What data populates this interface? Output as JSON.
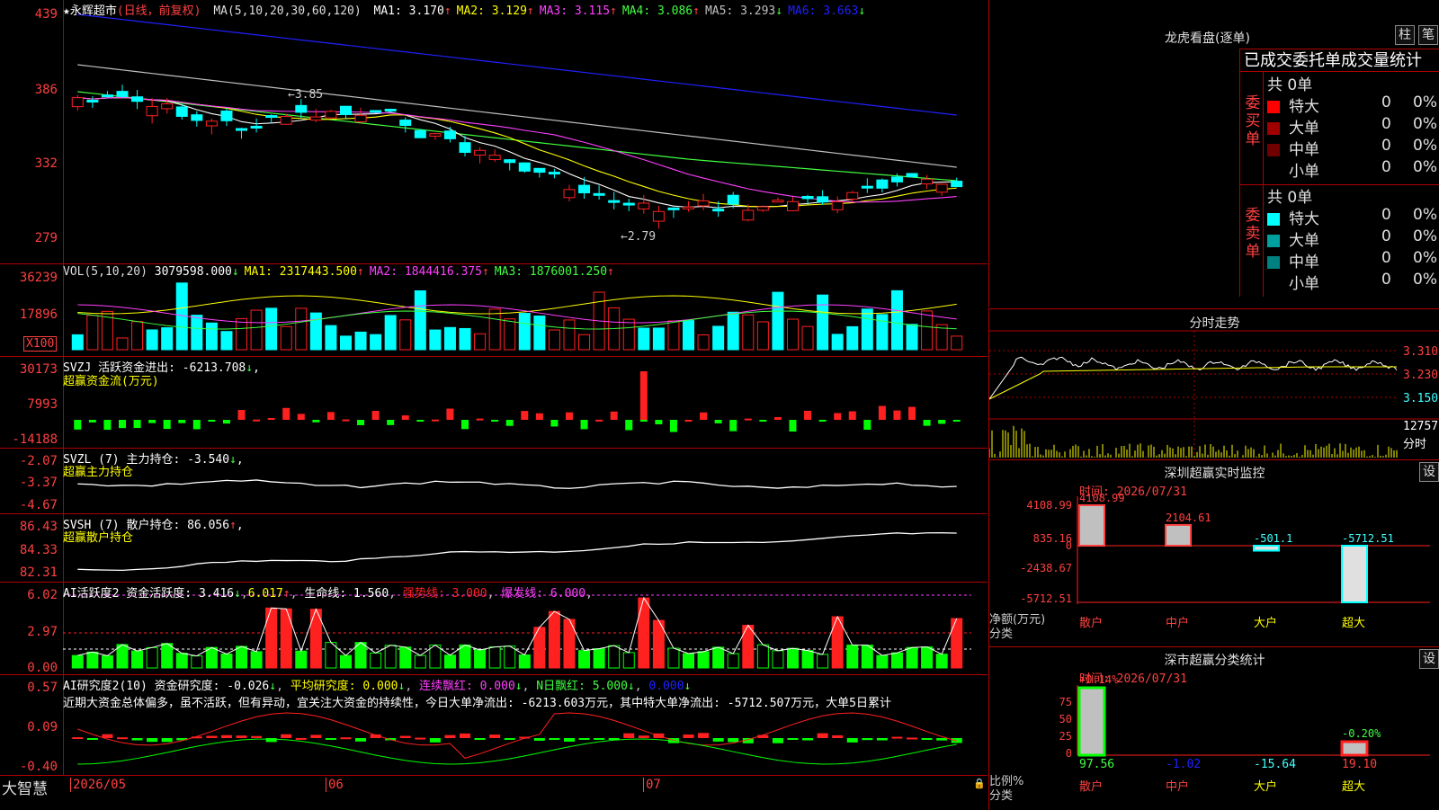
{
  "stock": {
    "name_prefix": "★",
    "name": "永辉超市",
    "period": "(日线，前复权)"
  },
  "main": {
    "ma_label": "MA(5,10,20,30,60,120)",
    "ma": [
      {
        "k": "MA1:",
        "v": "3.170",
        "d": "↑",
        "color": "#ffffff"
      },
      {
        "k": "MA2:",
        "v": "3.129",
        "d": "↑",
        "color": "#ffff00"
      },
      {
        "k": "MA3:",
        "v": "3.115",
        "d": "↑",
        "color": "#ff40ff"
      },
      {
        "k": "MA4:",
        "v": "3.086",
        "d": "↑",
        "color": "#40ff40"
      },
      {
        "k": "MA5:",
        "v": "3.293",
        "d": "↓",
        "color": "#c0c0c0"
      },
      {
        "k": "MA6:",
        "v": "3.663",
        "d": "↓",
        "color": "#2020ff"
      }
    ],
    "y_ticks": [
      "439",
      "386",
      "332",
      "279"
    ],
    "high_label": "3.85",
    "low_label": "2.79"
  },
  "vol": {
    "label": "VOL(5,10,20)",
    "v": "3079598.000",
    "vd": "↓",
    "ma": [
      {
        "k": "MA1:",
        "v": "2317443.500",
        "d": "↑",
        "color": "#ffff00"
      },
      {
        "k": "MA2:",
        "v": "1844416.375",
        "d": "↑",
        "color": "#ff40ff"
      },
      {
        "k": "MA3:",
        "v": "1876001.250",
        "d": "↑",
        "color": "#40ff40"
      }
    ],
    "y_ticks": [
      "36239",
      "17896"
    ],
    "unit": "X100"
  },
  "svzj": {
    "line1": "SVZJ  活跃资金进出: -6213.708",
    "d": "↓",
    "line2": "超赢资金流(万元)",
    "y_ticks": [
      "30173",
      "7993",
      "-14188"
    ]
  },
  "svzl": {
    "line1": "SVZL (7) 主力持仓: -3.540",
    "d": "↓",
    "line2": "超赢主力持仓",
    "y_ticks": [
      "-2.07",
      "-3.37",
      "-4.67"
    ]
  },
  "svsh": {
    "line1": "SVSH (7) 散户持仓: 86.056",
    "d": "↑",
    "line2": "超赢散户持仓",
    "y_ticks": [
      "86.43",
      "84.33",
      "82.31"
    ]
  },
  "ai1": {
    "t1": "AI活跃度2 资金活跃度: 3.416",
    "t2": "6.017",
    "t3": "生命线: 1.560",
    "t4": "强势线: 3.000",
    "t5": "爆发线: 6.000",
    "y_ticks": [
      "6.02",
      "2.97",
      "0.00"
    ]
  },
  "ai2": {
    "t1": "AI研究度2(10) 资金研究度: -0.026",
    "t2": "平均研究度: 0.000",
    "t3": "连续飘红: 0.000",
    "t4": "N日飘红: 5.000",
    "t5": "0.000",
    "commentary": "近期大资金总体偏多，虽不活跃，但有异动，宜关注大资金的持续性，今日大单净流出: -6213.603万元，其中特大单净流出: -5712.507万元，大单5日累计",
    "y_ticks": [
      "0.57",
      "0.09",
      "-0.40"
    ]
  },
  "xaxis": {
    "brand": "大智慧",
    "labels": [
      "2026/05",
      "06",
      "07"
    ]
  },
  "lhb": {
    "title": "龙虎看盘(逐单)",
    "btn1": "柱",
    "btn2": "笔",
    "header": "已成交委托单成交量统计",
    "buy_total": "共 0单",
    "buy_label": "委买单",
    "sell_total": "共 0单",
    "sell_label": "委卖单",
    "buy": [
      {
        "n": "特大",
        "v": "0",
        "p": "0%",
        "c": "#ff0000"
      },
      {
        "n": "大单",
        "v": "0",
        "p": "0%",
        "c": "#a00000"
      },
      {
        "n": "中单",
        "v": "0",
        "p": "0%",
        "c": "#700000"
      },
      {
        "n": "小单",
        "v": "0",
        "p": "0%",
        "c": "#000000"
      }
    ],
    "sell": [
      {
        "n": "特大",
        "v": "0",
        "p": "0%",
        "c": "#00ffff"
      },
      {
        "n": "大单",
        "v": "0",
        "p": "0%",
        "c": "#00a0a0"
      },
      {
        "n": "中单",
        "v": "0",
        "p": "0%",
        "c": "#008080"
      },
      {
        "n": "小单",
        "v": "0",
        "p": "0%",
        "c": "#000000"
      }
    ]
  },
  "fenshi": {
    "title": "分时走势",
    "y": [
      "3.310",
      "3.230",
      "3.150"
    ],
    "vol": "12757",
    "unit": "分时"
  },
  "monitor": {
    "title": "深圳超赢实时监控",
    "btn": "设",
    "time": "时间: 2026/07/31",
    "y": [
      "4108.99",
      "835.16",
      "0",
      "-2438.67",
      "-5712.51"
    ],
    "ylab1": "净额(万元)",
    "ylab2": "分类",
    "cats": [
      "散户",
      "中户",
      "大户",
      "超大"
    ],
    "vals": [
      "4108.99",
      "2104.61",
      "-501.1",
      "-5712.51"
    ]
  },
  "classify": {
    "title": "深市超赢分类统计",
    "btn": "设",
    "time": "时间: 2026/07/31",
    "top": "+0.14%",
    "neg": "-0.20%",
    "y": [
      "75",
      "50",
      "25",
      "0"
    ],
    "ylab1": "比例%",
    "ylab2": "分类",
    "cats": [
      "散户",
      "中户",
      "大户",
      "超大"
    ],
    "vals": [
      "97.56",
      "-1.02",
      "-15.64",
      "19.10"
    ]
  }
}
